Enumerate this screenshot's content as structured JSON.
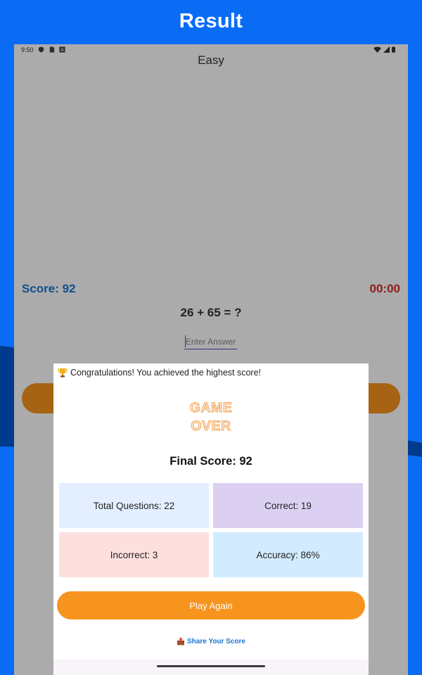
{
  "header": {
    "title": "Result"
  },
  "status_bar": {
    "time": "9:50"
  },
  "app": {
    "title": "Easy"
  },
  "game": {
    "score_label": "Score: 92",
    "timer": "00:00",
    "question": "26 + 65 = ?",
    "answer_placeholder": "Enter Answer"
  },
  "dialog": {
    "congrats": "Congratulations! You achieved the highest score!",
    "game_over_line1": "GAME",
    "game_over_line2": "OVER",
    "final_score": "Final Score: 92",
    "stats": {
      "total": "Total Questions: 22",
      "correct": "Correct: 19",
      "incorrect": "Incorrect: 3",
      "accuracy": "Accuracy: 86%"
    },
    "play_again": "Play Again",
    "share": "Share Your Score"
  },
  "colors": {
    "background": "#0a6cf5",
    "background_wave": "#003a8c",
    "accent_orange": "#f7941d",
    "score_blue": "#1976d2",
    "timer_red": "#d32f2f"
  },
  "icons": [
    "shield-icon",
    "sim-icon",
    "a-icon",
    "wifi-icon",
    "signal-icon",
    "battery-icon",
    "trophy-icon",
    "share-icon"
  ]
}
